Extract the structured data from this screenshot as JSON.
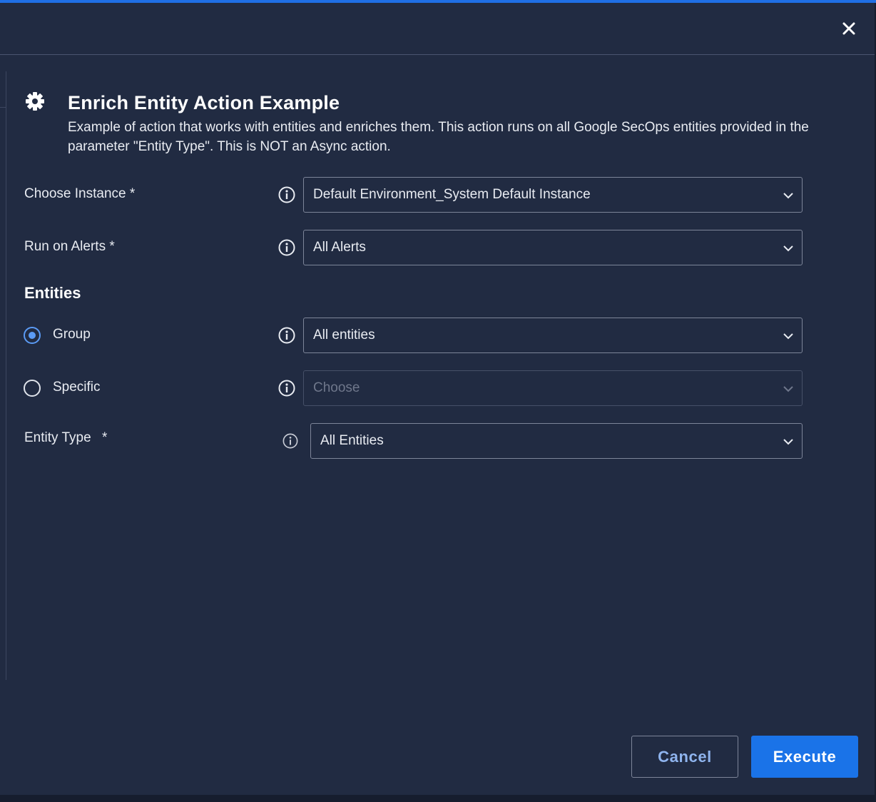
{
  "dialog": {
    "title": "Enrich Entity Action Example",
    "description": "Example of action that works with entities and enriches them. This action runs on all Google SecOps entities provided in the parameter \"Entity Type\". This is NOT an Async action.",
    "title_icon": "gear-icon",
    "close_icon": "close-icon"
  },
  "fields": {
    "instance": {
      "label": "Choose Instance *",
      "value": "Default Environment_System Default Instance"
    },
    "alerts": {
      "label": "Run on Alerts *",
      "value": "All Alerts"
    },
    "entity_type": {
      "label": "Entity Type",
      "required_marker": "*",
      "value": "All Entities"
    }
  },
  "entities": {
    "heading": "Entities",
    "group": {
      "label": "Group",
      "checked": true,
      "value": "All entities"
    },
    "specific": {
      "label": "Specific",
      "checked": false,
      "placeholder": "Choose"
    }
  },
  "buttons": {
    "cancel": "Cancel",
    "execute": "Execute"
  },
  "colors": {
    "background": "#212b42",
    "accent": "#1a73e8",
    "radio_selected": "#5b9bf5"
  }
}
